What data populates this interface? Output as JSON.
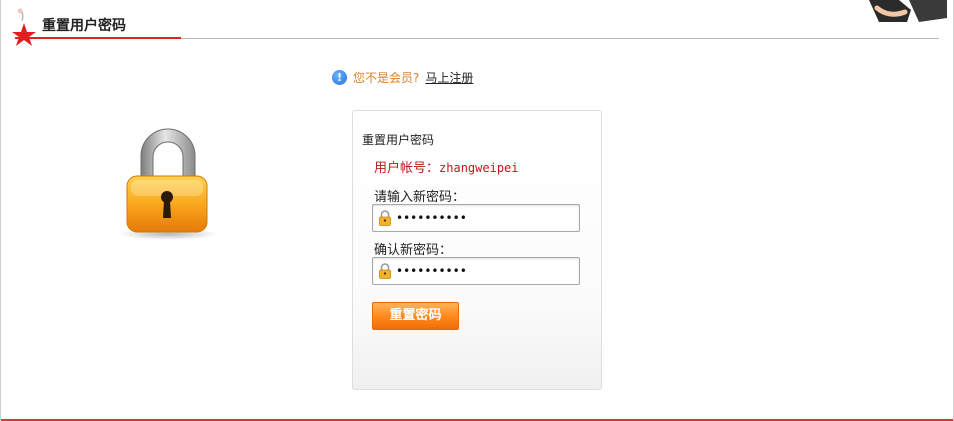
{
  "header": {
    "title": "重置用户密码"
  },
  "notice": {
    "text": "您不是会员?",
    "link_label": "马上注册"
  },
  "form": {
    "title": "重置用户密码",
    "account_label": "用户帐号：",
    "account_value": "zhangweipei",
    "new_password_label": "请输入新密码：",
    "new_password_value": "••••••••••",
    "confirm_password_label": "确认新密码：",
    "confirm_password_value": "••••••••••",
    "submit_label": "重置密码"
  },
  "icons": {
    "header": "red-star-icon",
    "notice": "info-icon",
    "illustration": "padlock-icon",
    "field": "small-lock-icon"
  },
  "colors": {
    "accent_red": "#d22222",
    "button_orange": "#ff8a1e",
    "notice_orange": "#d9822b",
    "account_red": "#c01818"
  }
}
